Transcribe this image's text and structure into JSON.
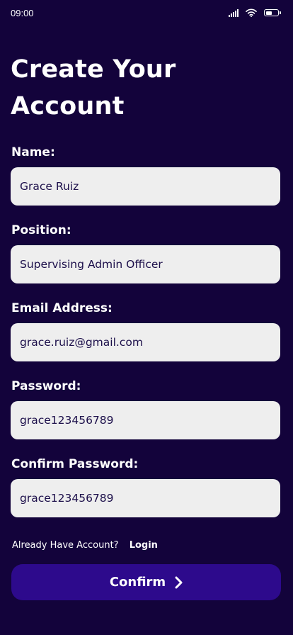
{
  "status_bar": {
    "time": "09:00"
  },
  "page": {
    "title": "Create Your Account"
  },
  "form": {
    "name": {
      "label": "Name:",
      "value": "Grace Ruiz"
    },
    "position": {
      "label": "Position:",
      "value": "Supervising Admin Officer"
    },
    "email": {
      "label": "Email Address:",
      "value": "grace.ruiz@gmail.com"
    },
    "password": {
      "label": "Password:",
      "value": "grace123456789"
    },
    "confirm_password": {
      "label": "Confirm Password:",
      "value": "grace123456789"
    }
  },
  "login_prompt": {
    "text": "Already Have Account?",
    "link_label": "Login"
  },
  "confirm_button": {
    "label": "Confirm"
  },
  "colors": {
    "background": "#13033b",
    "input_background": "#eeeeee",
    "input_text": "#1c0f4a",
    "button": "#2d0a8c"
  },
  "battery_level": 0.55
}
